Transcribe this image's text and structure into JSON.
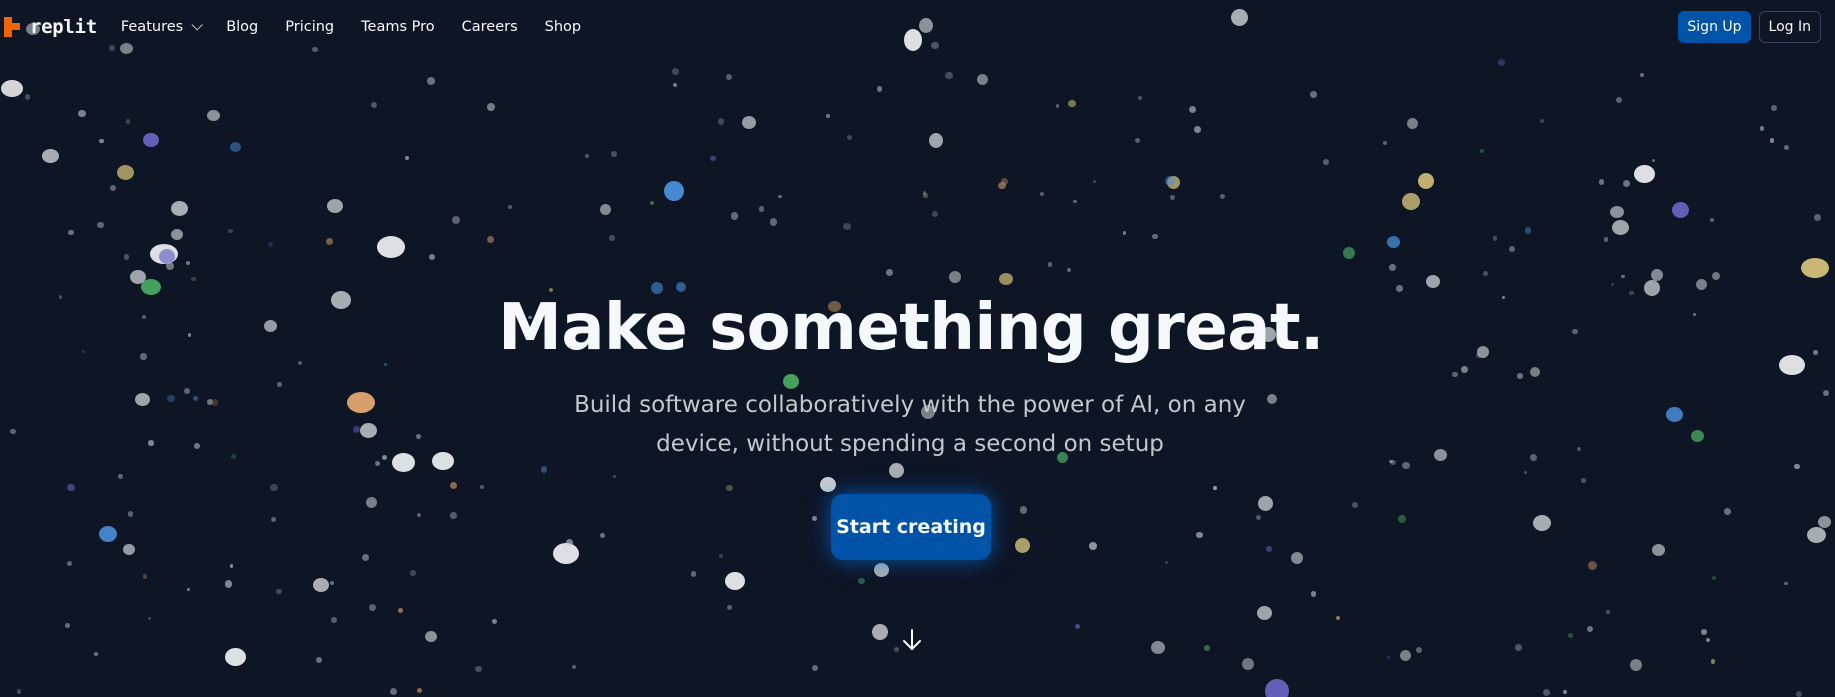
{
  "nav": {
    "logo_text": "replit",
    "links": [
      {
        "label": "Features",
        "has_dropdown": true
      },
      {
        "label": "Blog"
      },
      {
        "label": "Pricing"
      },
      {
        "label": "Teams Pro"
      },
      {
        "label": "Careers"
      },
      {
        "label": "Shop"
      }
    ],
    "signup_label": "Sign Up",
    "login_label": "Log In"
  },
  "hero": {
    "title": "Make something great.",
    "subtitle": "Build software collaboratively with the power of AI, on any device, without spending a second on setup",
    "cta_label": "Start creating",
    "scroll_icon": "arrow-down-icon"
  },
  "colors": {
    "background": "#0e1525",
    "brand_orange": "#f26207",
    "primary_blue": "#0053a6",
    "text_primary": "#f5f9fc",
    "text_secondary": "#c2c8cc",
    "particle_palette": [
      "#c2c8cc",
      "#e8ebed",
      "#4a8fd9",
      "#6b68c7",
      "#4caf64",
      "#e2a872",
      "#d4c07a",
      "#b38a62"
    ]
  }
}
